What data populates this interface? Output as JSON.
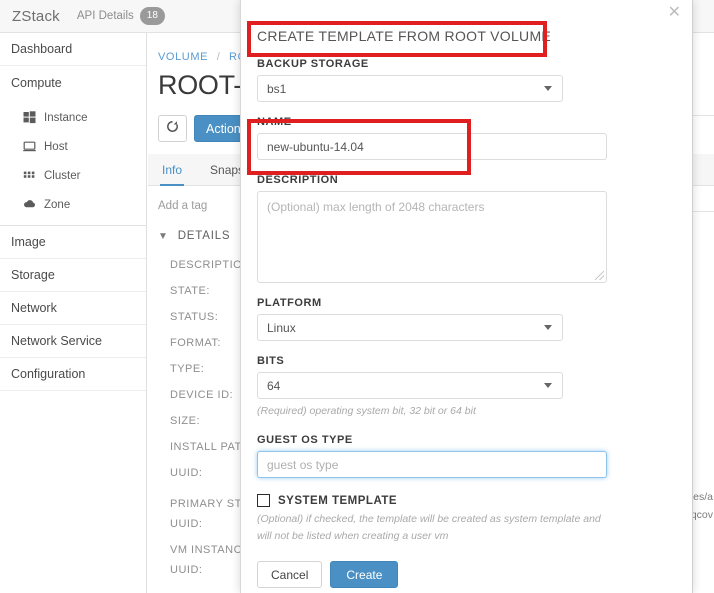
{
  "topbar": {
    "brand": "ZStack",
    "api_details_label": "API Details",
    "api_details_count": "18"
  },
  "sidebar": {
    "items": [
      {
        "label": "Dashboard",
        "icon": "none"
      },
      {
        "label": "Compute",
        "icon": "none"
      }
    ],
    "sub_items": [
      {
        "label": "Instance",
        "icon": "instance-icon"
      },
      {
        "label": "Host",
        "icon": "host-icon"
      },
      {
        "label": "Cluster",
        "icon": "cluster-icon"
      },
      {
        "label": "Zone",
        "icon": "zone-icon"
      }
    ],
    "items_bottom": [
      {
        "label": "Image",
        "icon": "none"
      },
      {
        "label": "Storage",
        "icon": "none"
      },
      {
        "label": "Network",
        "icon": "none"
      },
      {
        "label": "Network Service",
        "icon": "none"
      },
      {
        "label": "Configuration",
        "icon": "none"
      }
    ]
  },
  "content": {
    "breadcrumb": {
      "root": "VOLUME",
      "separator": "/",
      "current": "ROO"
    },
    "page_title": "ROOT-",
    "toolbar": {
      "refresh_icon": "refresh-icon",
      "action_label": "Action"
    },
    "tabs": [
      {
        "label": "Info",
        "active": true
      },
      {
        "label": "Snapsh",
        "active": false
      }
    ],
    "add_tag": "Add a tag",
    "details_header": "DETAILS",
    "detail_rows": [
      "DESCRIPTION",
      "STATE:",
      "STATUS:",
      "FORMAT:",
      "TYPE:",
      "DEVICE ID:",
      "SIZE:",
      "INSTALL PATH",
      "UUID:",
      "PRIMARY STO",
      "UUID:",
      "VM INSTANCE",
      "UUID:"
    ],
    "right_leak": [
      "es/a",
      "qcov"
    ]
  },
  "modal": {
    "close_icon": "close-icon",
    "title": "CREATE TEMPLATE FROM ROOT VOLUME",
    "backup_storage": {
      "label": "BACKUP STORAGE",
      "value": "bs1",
      "chevron_icon": "chevron-down-icon"
    },
    "name": {
      "label": "NAME",
      "value": "new-ubuntu-14.04"
    },
    "description": {
      "label": "DESCRIPTION",
      "placeholder": "(Optional) max length of 2048 characters",
      "value": ""
    },
    "platform": {
      "label": "PLATFORM",
      "value": "Linux",
      "chevron_icon": "chevron-down-icon"
    },
    "bits": {
      "label": "BITS",
      "value": "64",
      "chevron_icon": "chevron-down-icon",
      "hint": "(Required) operating system bit, 32 bit or 64 bit"
    },
    "guest_os_type": {
      "label": "GUEST OS TYPE",
      "placeholder": "guest os type",
      "value": ""
    },
    "system_template": {
      "label": "SYSTEM TEMPLATE",
      "checked": false,
      "hint_line1": "(Optional) if checked, the template will be created as system template and",
      "hint_line2": "will not be listed when creating a user vm"
    },
    "footer": {
      "cancel_label": "Cancel",
      "create_label": "Create"
    }
  },
  "colors": {
    "accent_blue": "#4a90c4",
    "annotation_red": "#e02020",
    "link_blue": "#5b9bd5",
    "badge_gray": "#9a9a9a"
  }
}
